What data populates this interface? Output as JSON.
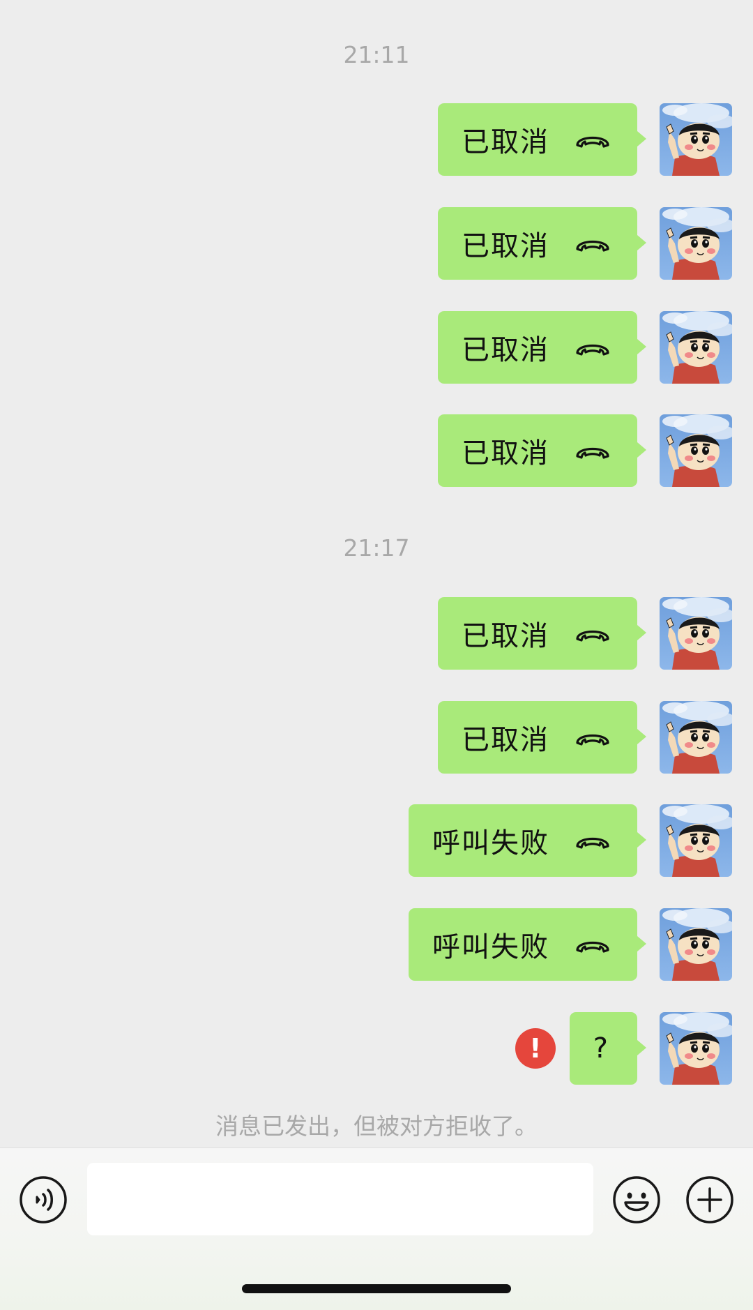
{
  "timestamps": [
    "21:11",
    "21:17"
  ],
  "messages": [
    {
      "text": "已取消",
      "icon": "phone-hangup-icon"
    },
    {
      "text": "已取消",
      "icon": "phone-hangup-icon"
    },
    {
      "text": "已取消",
      "icon": "phone-hangup-icon"
    },
    {
      "text": "已取消",
      "icon": "phone-hangup-icon"
    },
    {
      "text": "已取消",
      "icon": "phone-hangup-icon"
    },
    {
      "text": "已取消",
      "icon": "phone-hangup-icon"
    },
    {
      "text": "呼叫失败",
      "icon": "phone-hangup-icon"
    },
    {
      "text": "呼叫失败",
      "icon": "phone-hangup-icon"
    },
    {
      "text": "?",
      "status_icon": "error-exclamation-icon",
      "status_text": "!"
    }
  ],
  "system_notice": "消息已发出，但被对方拒收了。",
  "input_bar": {
    "value": "",
    "left_icon": "voice-icon",
    "right_icons": [
      "emoji-icon",
      "plus-icon"
    ]
  },
  "colors": {
    "background": "#ededed",
    "bubble": "#a9ea7a",
    "error": "#e5463c",
    "muted_text": "#a8a8a8"
  }
}
